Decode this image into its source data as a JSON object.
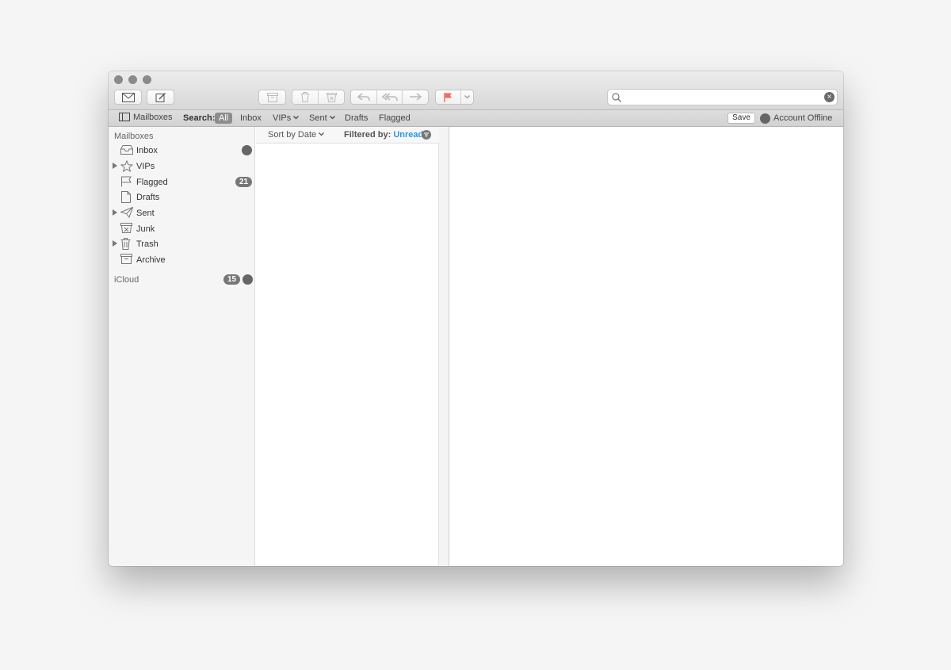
{
  "toolbar": {
    "get_mail_icon": "envelope-icon",
    "compose_icon": "compose-icon",
    "archive_icon": "archive-icon",
    "delete_icon": "trash-icon",
    "junk_icon": "junk-icon",
    "reply_icon": "reply-icon",
    "reply_all_icon": "reply-all-icon",
    "forward_icon": "forward-icon",
    "flag_icon": "flag-icon",
    "flag_color": "#f26b5b",
    "search_value": "",
    "search_placeholder": ""
  },
  "favorites": {
    "mailboxes_label": "Mailboxes",
    "search_label": "Search:",
    "scopes": {
      "all": "All",
      "inbox": "Inbox",
      "vips": "VIPs",
      "sent": "Sent",
      "drafts": "Drafts",
      "flagged": "Flagged"
    },
    "save_label": "Save",
    "account_status": "Account Offline"
  },
  "sidebar": {
    "section_title": "Mailboxes",
    "items": [
      {
        "label": "Inbox",
        "icon": "inbox-icon",
        "badge": ""
      },
      {
        "label": "VIPs",
        "icon": "star-icon",
        "badge": ""
      },
      {
        "label": "Flagged",
        "icon": "flag-icon",
        "badge": "21"
      },
      {
        "label": "Drafts",
        "icon": "document-icon",
        "badge": ""
      },
      {
        "label": "Sent",
        "icon": "paper-plane-icon",
        "badge": ""
      },
      {
        "label": "Junk",
        "icon": "junk-icon",
        "badge": ""
      },
      {
        "label": "Trash",
        "icon": "trash-icon",
        "badge": ""
      },
      {
        "label": "Archive",
        "icon": "archive-icon",
        "badge": ""
      }
    ],
    "account": {
      "label": "iCloud",
      "badge": "15"
    }
  },
  "message_list": {
    "sort_label": "Sort by Date",
    "filter_label": "Filtered by:",
    "filter_value": "Unread",
    "filter_color": "#2d95e1"
  }
}
